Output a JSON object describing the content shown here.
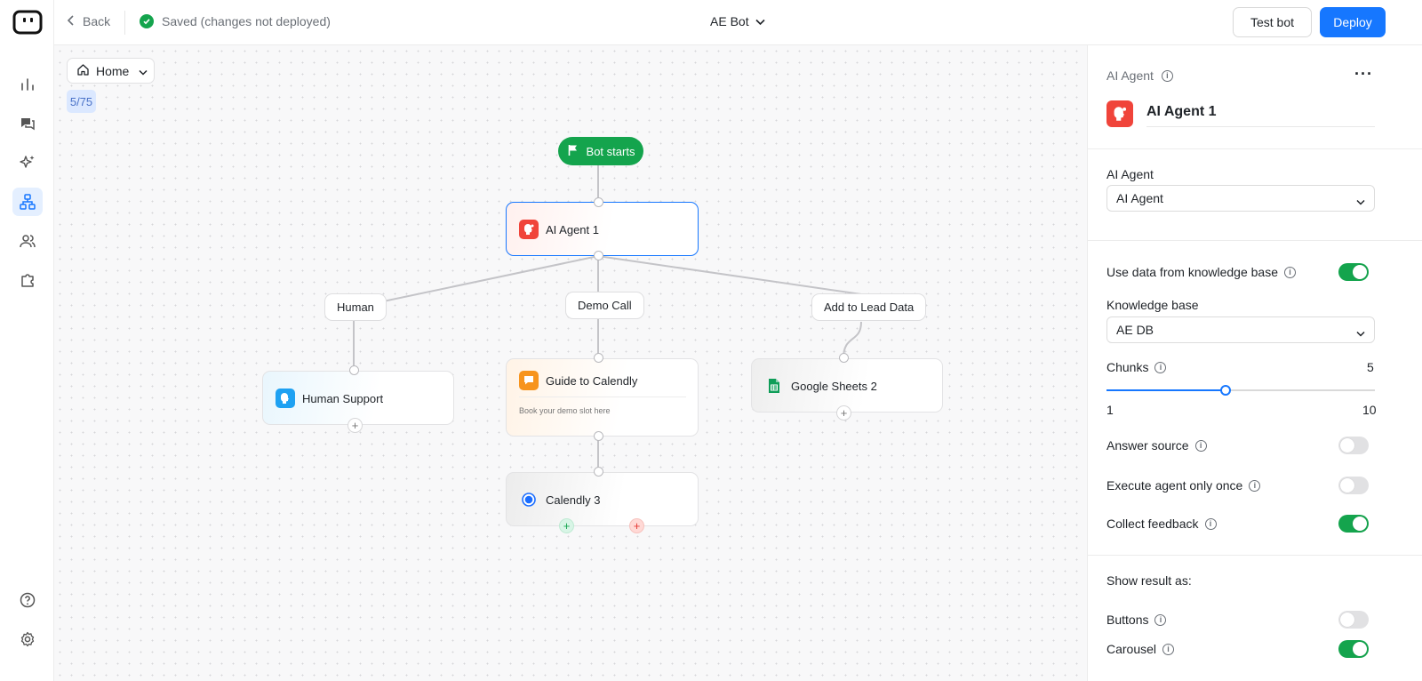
{
  "topbar": {
    "back_label": "Back",
    "status": "Saved (changes not deployed)",
    "bot_name": "AE Bot",
    "test_label": "Test bot",
    "deploy_label": "Deploy"
  },
  "rail": {
    "items": [
      "analytics",
      "conversations",
      "ai",
      "flows",
      "users",
      "integrations"
    ],
    "active": "flows",
    "bottom": [
      "help",
      "settings"
    ]
  },
  "canvas": {
    "home_label": "Home",
    "counter": "5/75",
    "start_label": "Bot starts",
    "nodes": {
      "ai": "AI Agent 1",
      "human": "Human Support",
      "guide": "Guide to Calendly",
      "guide_sub": "Book your demo slot here",
      "sheets": "Google Sheets 2",
      "calendly": "Calendly 3"
    },
    "branches": {
      "human": "Human",
      "demo": "Demo Call",
      "lead": "Add to Lead Data"
    }
  },
  "panel": {
    "header": "AI Agent",
    "agent_name": "AI Agent 1",
    "agent_label": "AI Agent",
    "agent_value": "AI Agent",
    "use_kb_label": "Use data from knowledge base",
    "use_kb_on": true,
    "kb_label": "Knowledge base",
    "kb_value": "AE DB",
    "chunks_label": "Chunks",
    "chunks_value": "5",
    "chunks_min": "1",
    "chunks_max": "10",
    "answer_source_label": "Answer source",
    "answer_source_on": false,
    "execute_once_label": "Execute agent only once",
    "execute_once_on": false,
    "feedback_label": "Collect feedback",
    "feedback_on": true,
    "show_result_label": "Show result as:",
    "buttons_label": "Buttons",
    "buttons_on": false,
    "carousel_label": "Carousel",
    "carousel_on": true
  },
  "colors": {
    "accent": "#1677ff",
    "success": "#14a44d",
    "ai_icon": "#f0443a",
    "human_icon": "#1ea1f2",
    "guide_icon": "#f7941d",
    "sheets_icon": "#0f9d58"
  }
}
